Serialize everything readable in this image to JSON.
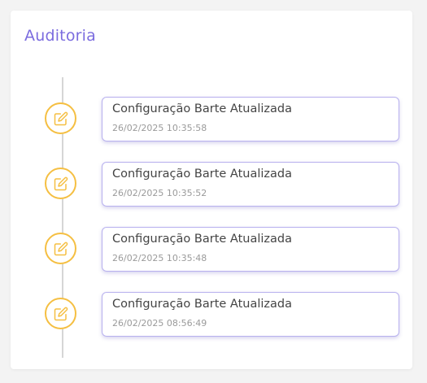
{
  "card": {
    "title": "Auditoria"
  },
  "timeline": {
    "items": [
      {
        "icon": "edit-icon",
        "title": "Configuração Barte Atualizada",
        "date": "26/02/2025 10:35:58"
      },
      {
        "icon": "edit-icon",
        "title": "Configuração Barte Atualizada",
        "date": "26/02/2025 10:35:52"
      },
      {
        "icon": "edit-icon",
        "title": "Configuração Barte Atualizada",
        "date": "26/02/2025 10:35:48"
      },
      {
        "icon": "edit-icon",
        "title": "Configuração Barte Atualizada",
        "date": "26/02/2025 08:56:49"
      }
    ]
  },
  "colors": {
    "accent": "#7b6cdf",
    "icon": "#f5bf42",
    "box_border": "#b7b0ee"
  }
}
